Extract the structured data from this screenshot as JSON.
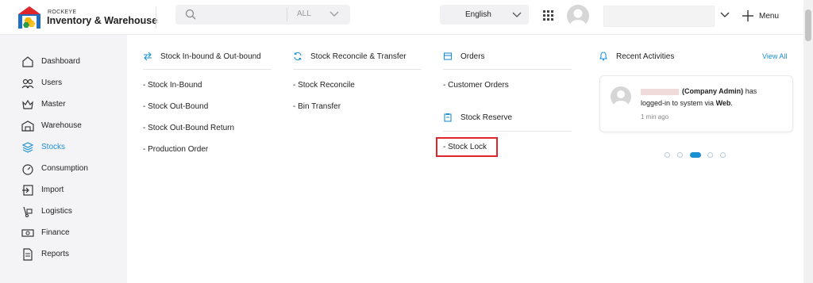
{
  "header": {
    "brand_small": "ROCKEYE",
    "brand_title": "Inventory & Warehouse",
    "search_placeholder": "",
    "search_scope": "ALL",
    "language": "English",
    "menu_label": "Menu"
  },
  "sidebar": {
    "items": [
      {
        "label": "Dashboard",
        "icon": "home-icon"
      },
      {
        "label": "Users",
        "icon": "users-icon"
      },
      {
        "label": "Master",
        "icon": "crown-icon"
      },
      {
        "label": "Warehouse",
        "icon": "warehouse-icon"
      },
      {
        "label": "Stocks",
        "icon": "layers-icon",
        "active": true
      },
      {
        "label": "Consumption",
        "icon": "gauge-icon"
      },
      {
        "label": "Import",
        "icon": "import-icon"
      },
      {
        "label": "Logistics",
        "icon": "dolly-icon"
      },
      {
        "label": "Finance",
        "icon": "cash-icon"
      },
      {
        "label": "Reports",
        "icon": "document-icon"
      }
    ],
    "active_color": "#1a8fd1"
  },
  "mega_menu": {
    "col1": {
      "title": "Stock In-bound & Out-bound",
      "links": [
        "- Stock In-Bound",
        "- Stock Out-Bound",
        "- Stock Out-Bound Return",
        "- Production Order"
      ]
    },
    "col2": {
      "title": "Stock Reconcile & Transfer",
      "links": [
        "- Stock Reconcile",
        "- Bin Transfer"
      ]
    },
    "col3": {
      "orders_title": "Orders",
      "orders_links": [
        "- Customer Orders"
      ],
      "reserve_title": "Stock Reserve",
      "reserve_links": [
        "- Stock Lock"
      ]
    },
    "highlight_color": "#e0262b"
  },
  "recent_activities": {
    "title": "Recent Activities",
    "view_all": "View All",
    "item": {
      "role": "(Company Admin)",
      "text1": "has",
      "text2": "logged-in to system via",
      "via": "Web",
      "tail": ".",
      "time": "1 min ago"
    },
    "pagination": {
      "count": 5,
      "active_index": 2
    }
  }
}
